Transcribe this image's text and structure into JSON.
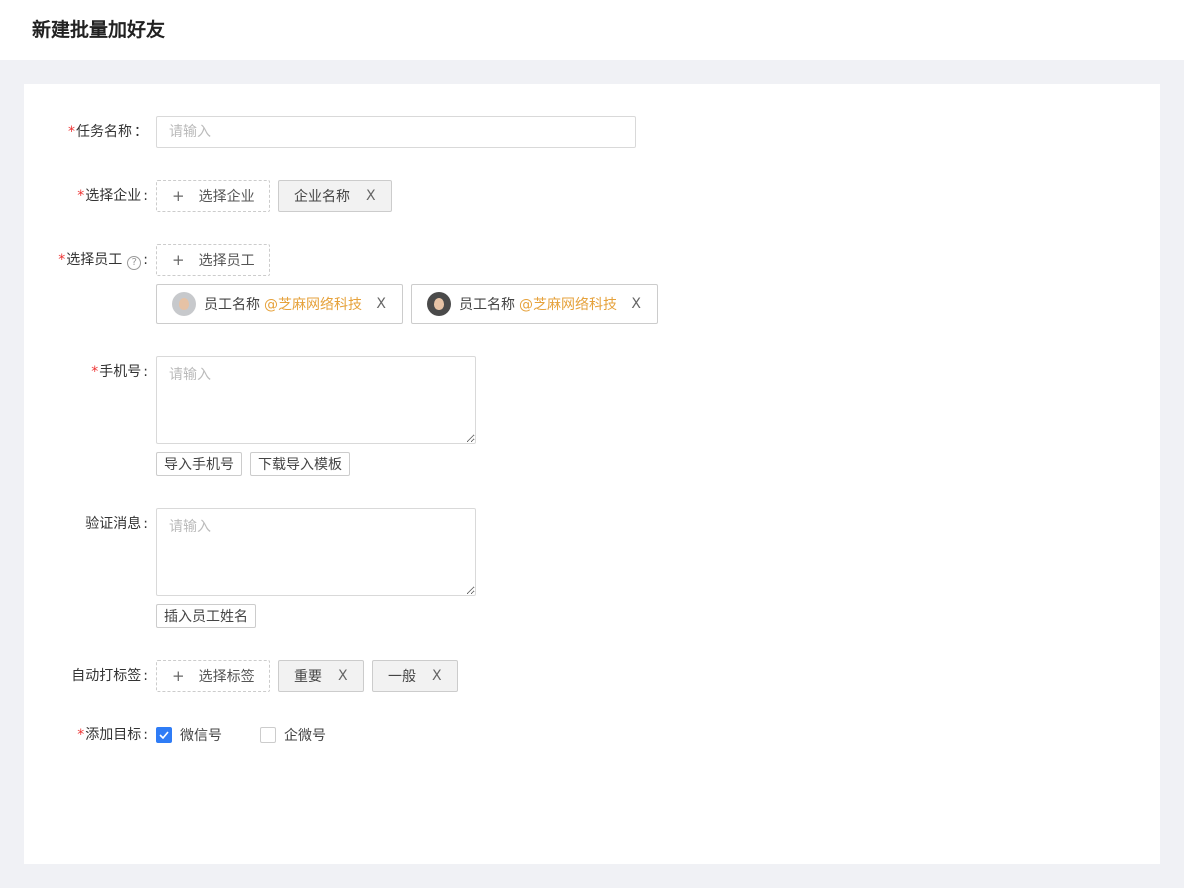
{
  "page": {
    "title": "新建批量加好友"
  },
  "form": {
    "task_name": {
      "label": "任务名称",
      "colon": "：",
      "placeholder": "请输入"
    },
    "company": {
      "label": "选择企业",
      "colon": ":",
      "button": "选择企业",
      "tags": [
        {
          "label": "企业名称",
          "close": "X"
        }
      ]
    },
    "employee": {
      "label": "选择员工",
      "colon": ":",
      "help": "?",
      "button": "选择员工",
      "tags": [
        {
          "name": "员工名称",
          "org": "@芝麻网络科技",
          "close": "X",
          "avatar": "avatar-light"
        },
        {
          "name": "员工名称",
          "org": "@芝麻网络科技",
          "close": "X",
          "avatar": "avatar-dark"
        }
      ]
    },
    "phone": {
      "label": "手机号",
      "colon": ":",
      "placeholder": "请输入",
      "import_button": "导入手机号",
      "download_button": "下载导入模板"
    },
    "verify": {
      "label": "验证消息",
      "colon": ":",
      "placeholder": "请输入",
      "insert_button": "插入员工姓名"
    },
    "auto_tag": {
      "label": "自动打标签",
      "colon": ":",
      "button": "选择标签",
      "tags": [
        {
          "label": "重要",
          "close": "X"
        },
        {
          "label": "一般",
          "close": "X"
        }
      ]
    },
    "target": {
      "label": "添加目标",
      "colon": ":",
      "options": [
        {
          "label": "微信号",
          "checked": true
        },
        {
          "label": "企微号",
          "checked": false
        }
      ]
    },
    "required_mark": "*",
    "plus_icon": "+"
  },
  "colors": {
    "required": "#ee3333",
    "accent": "#2f7cf6",
    "org_text": "#e6a23c"
  }
}
